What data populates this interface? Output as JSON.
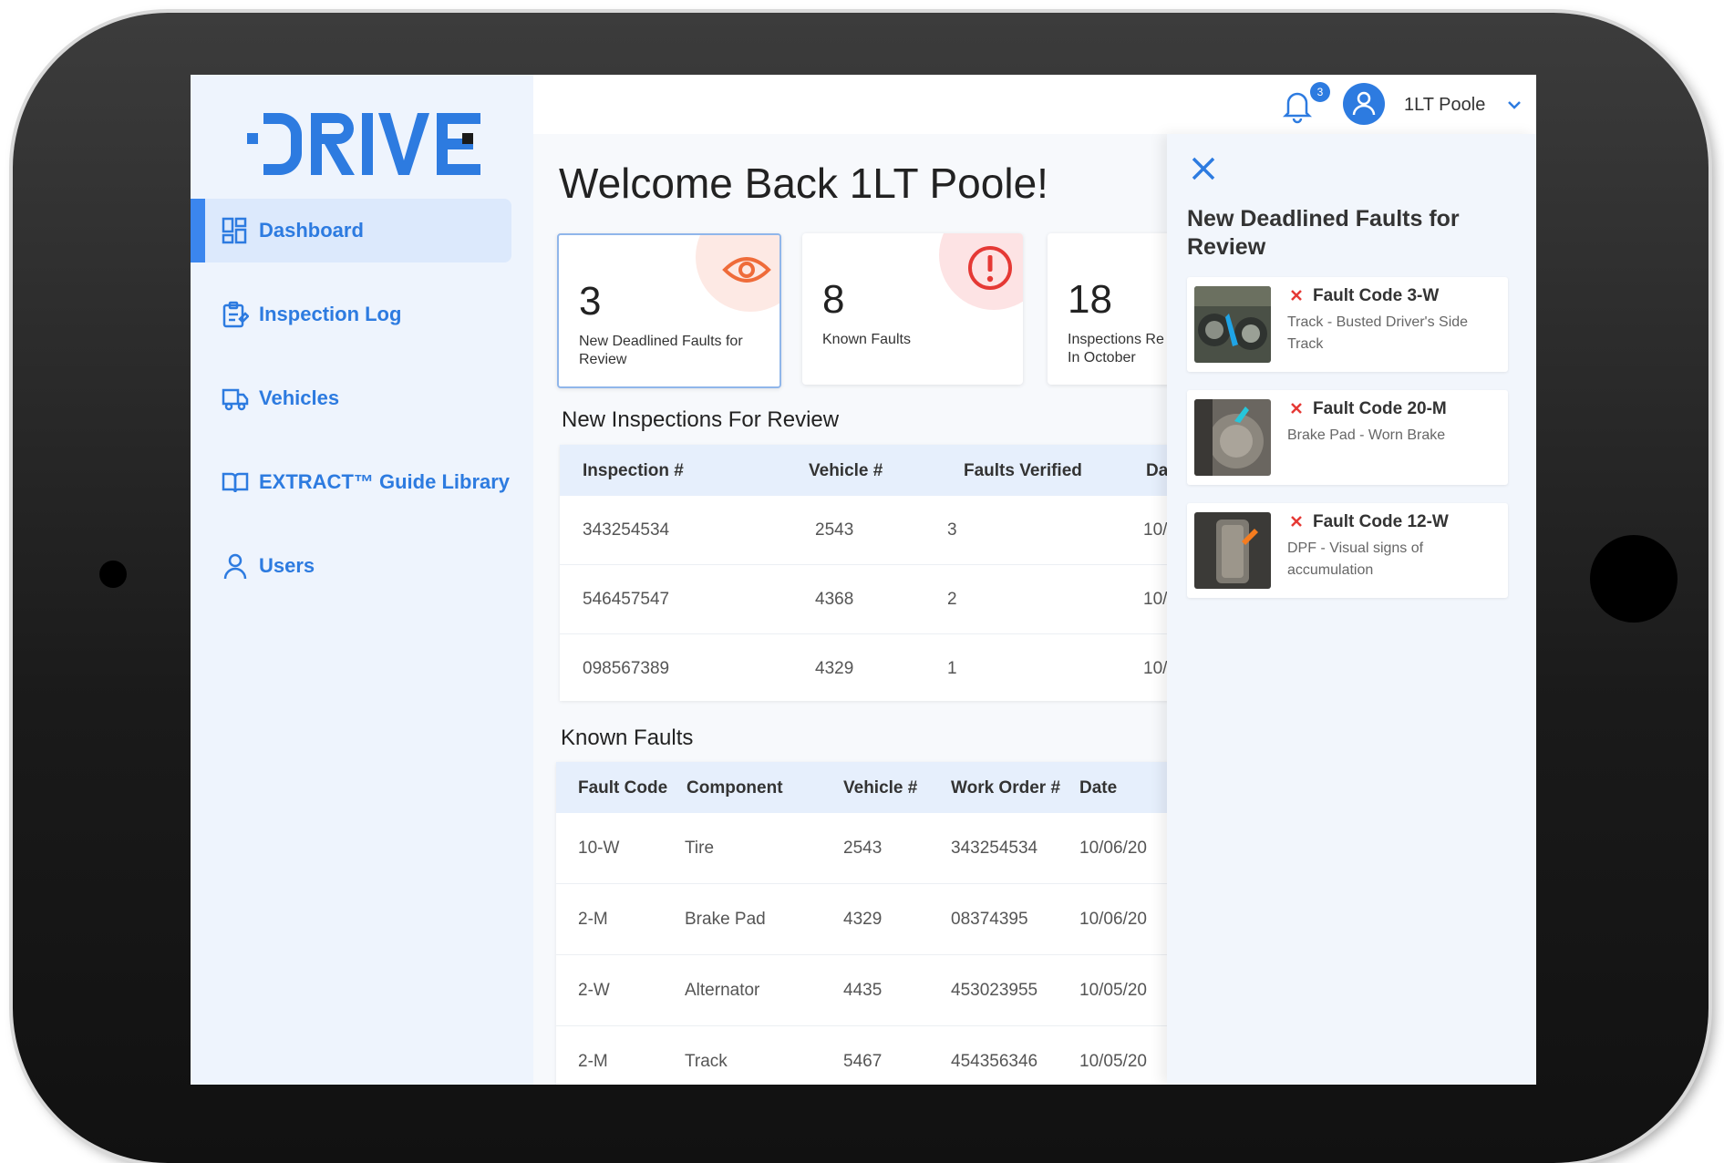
{
  "app": {
    "brand": "DRIVE"
  },
  "sidebar": {
    "items": [
      {
        "label": "Dashboard",
        "icon": "dashboard-icon",
        "active": true
      },
      {
        "label": "Inspection Log",
        "icon": "clipboard-icon"
      },
      {
        "label": "Vehicles",
        "icon": "truck-icon"
      },
      {
        "label": "EXTRACT™ Guide Library",
        "icon": "book-icon"
      },
      {
        "label": "Users",
        "icon": "user-icon"
      }
    ]
  },
  "header": {
    "notification_count": "3",
    "user_name": "1LT Poole"
  },
  "main": {
    "welcome": "Welcome Back 1LT Poole!",
    "cards": [
      {
        "value": "3",
        "label": "New Deadlined Faults for Review",
        "icon": "eye-icon"
      },
      {
        "value": "8",
        "label": "Known Faults",
        "icon": "alert-icon"
      },
      {
        "value": "18",
        "label": "Inspections Re\nIn October"
      }
    ],
    "inspections": {
      "title": "New Inspections For Review",
      "columns": [
        "Inspection #",
        "Vehicle #",
        "Faults Verified",
        "Da"
      ],
      "rows": [
        [
          "343254534",
          "2543",
          "3",
          "10/"
        ],
        [
          "546457547",
          "4368",
          "2",
          "10/"
        ],
        [
          "098567389",
          "4329",
          "1",
          "10/"
        ]
      ]
    },
    "known_faults": {
      "title": "Known Faults",
      "columns": [
        "Fault Code",
        "Component",
        "Vehicle #",
        "Work Order #",
        "Date"
      ],
      "rows": [
        [
          "10-W",
          "Tire",
          "2543",
          "343254534",
          "10/06/20"
        ],
        [
          "2-M",
          "Brake Pad",
          "4329",
          "08374395",
          "10/06/20"
        ],
        [
          "2-W",
          "Alternator",
          "4435",
          "453023955",
          "10/05/20"
        ],
        [
          "2-M",
          "Track",
          "5467",
          "454356346",
          "10/05/20"
        ]
      ]
    }
  },
  "panel": {
    "title": "New Deadlined Faults for Review",
    "faults": [
      {
        "code": "Fault Code 3-W",
        "description": "Track - Busted Driver's Side Track"
      },
      {
        "code": "Fault Code 20-M",
        "description": "Brake Pad - Worn Brake"
      },
      {
        "code": "Fault Code 12-W",
        "description": "DPF - Visual signs of accumulation"
      }
    ]
  },
  "colors": {
    "accent": "#2d7be0",
    "sidebar_bg": "#eef4fd",
    "danger": "#e53935",
    "warning_tint": "#fde7e3"
  }
}
